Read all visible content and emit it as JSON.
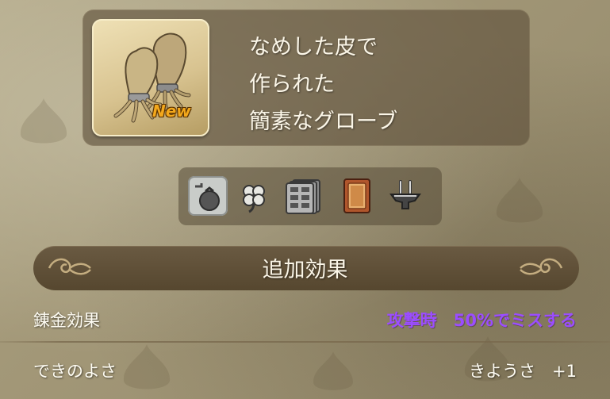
{
  "item": {
    "badge": "New",
    "description_lines": [
      "なめした皮で",
      "作られた",
      "簡素なグローブ"
    ]
  },
  "icons": [
    {
      "name": "pouch-icon"
    },
    {
      "name": "clover-icon"
    },
    {
      "name": "storage-icon"
    },
    {
      "name": "book-icon"
    },
    {
      "name": "anvil-icon"
    }
  ],
  "effects": {
    "title": "追加効果",
    "rows": [
      {
        "label": "錬金効果",
        "value": "攻撃時　50%でミスする",
        "color": "#9b4dff"
      },
      {
        "label": "できのよさ",
        "value": "きようさ　+1"
      }
    ]
  },
  "colors": {
    "panel": "#5c4e38",
    "text": "#fbf6e8",
    "alchemy_effect": "#9b4dff",
    "badge": "#f3a81c"
  }
}
